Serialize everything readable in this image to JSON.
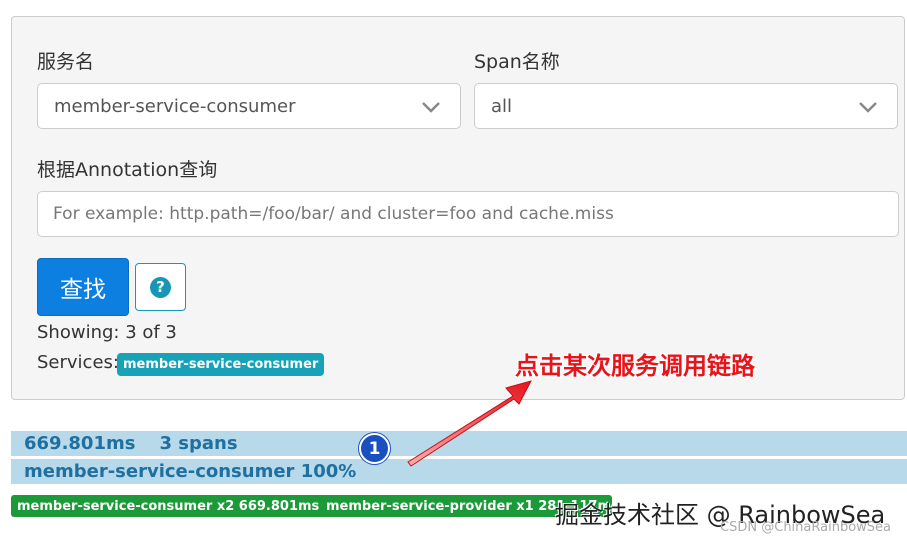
{
  "filters": {
    "service_label": "服务名",
    "service_value": "member-service-consumer",
    "span_label": "Span名称",
    "span_value": "all",
    "annotation_label": "根据Annotation查询",
    "annotation_placeholder": "For example: http.path=/foo/bar/ and cluster=foo and cache.miss",
    "search_button": "查找",
    "help_symbol": "?"
  },
  "results": {
    "showing": "Showing: 3 of 3",
    "services_label": "Services:",
    "service_badge": "member-service-consumer"
  },
  "trace": {
    "duration": "669.801ms",
    "spans": "3 spans",
    "service_percent": "member-service-consumer 100%",
    "tags": [
      "member-service-consumer x2 669.801ms",
      "member-service-provider x1 281.117ms"
    ]
  },
  "annotation": {
    "text": "点击某次服务调用链路",
    "marker": "1",
    "color": "#e6151b"
  },
  "watermark": {
    "main": "掘金技术社区 @ RainbowSea",
    "sub": "CSDN @ChinaRainbowSea"
  },
  "colors": {
    "primary": "#0d7fe0",
    "info": "#17a2b8",
    "success": "#1c9a3a",
    "trace_bar": "#b7d9ea"
  }
}
